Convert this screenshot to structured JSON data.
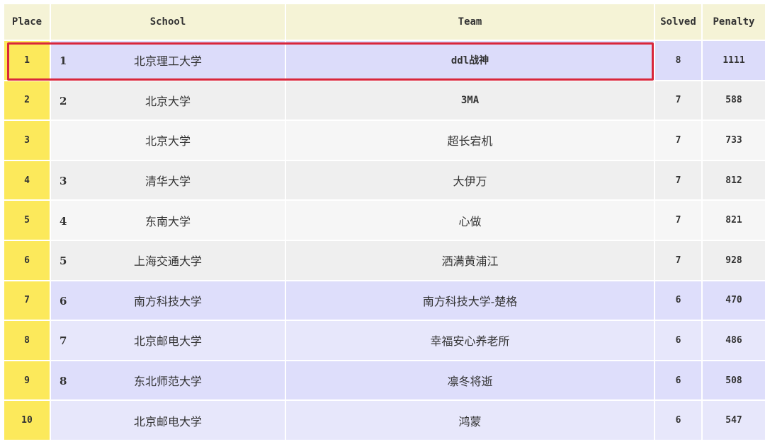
{
  "header": {
    "place": "Place",
    "school": "School",
    "team": "Team",
    "solved": "Solved",
    "penalty": "Penalty"
  },
  "rows": [
    {
      "place": "1",
      "school_rank": "1",
      "school": "北京理工大学",
      "team": "ddl战神",
      "solved": "8",
      "penalty": "1111"
    },
    {
      "place": "2",
      "school_rank": "2",
      "school": "北京大学",
      "team": "3MA",
      "solved": "7",
      "penalty": "588"
    },
    {
      "place": "3",
      "school_rank": "",
      "school": "北京大学",
      "team": "超长宕机",
      "solved": "7",
      "penalty": "733"
    },
    {
      "place": "4",
      "school_rank": "3",
      "school": "清华大学",
      "team": "大伊万",
      "solved": "7",
      "penalty": "812"
    },
    {
      "place": "5",
      "school_rank": "4",
      "school": "东南大学",
      "team": "心做",
      "solved": "7",
      "penalty": "821"
    },
    {
      "place": "6",
      "school_rank": "5",
      "school": "上海交通大学",
      "team": "洒满黄浦江",
      "solved": "7",
      "penalty": "928"
    },
    {
      "place": "7",
      "school_rank": "6",
      "school": "南方科技大学",
      "team": "南方科技大学-楚格",
      "solved": "6",
      "penalty": "470"
    },
    {
      "place": "8",
      "school_rank": "7",
      "school": "北京邮电大学",
      "team": "幸福安心养老所",
      "solved": "6",
      "penalty": "486"
    },
    {
      "place": "9",
      "school_rank": "8",
      "school": "东北师范大学",
      "team": "凛冬将逝",
      "solved": "6",
      "penalty": "508"
    },
    {
      "place": "10",
      "school_rank": "",
      "school": "北京邮电大学",
      "team": "鸿蒙",
      "solved": "6",
      "penalty": "547"
    }
  ],
  "colors": {
    "header_bg": "#f5f3d6",
    "place_bg": "#fce95b",
    "gold_bg": "#dcdcfa",
    "silver_bg_a": "#efefef",
    "silver_bg_b": "#f6f6f6",
    "bronze_bg_a": "#dedefb",
    "bronze_bg_b": "#e7e7fb",
    "highlight_border": "#d9263b"
  }
}
